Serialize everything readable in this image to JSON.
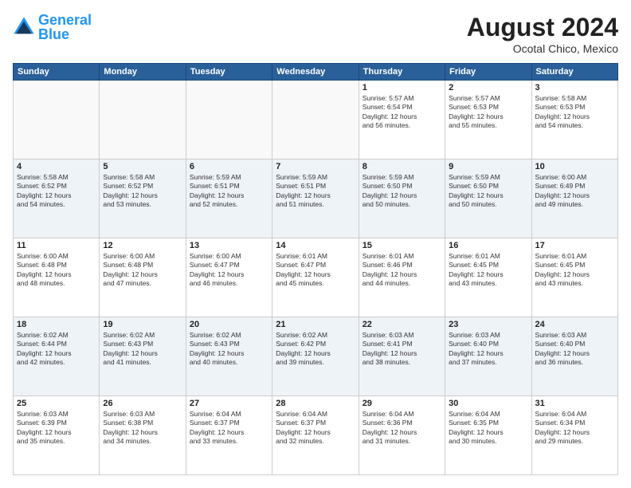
{
  "header": {
    "logo_general": "General",
    "logo_blue": "Blue",
    "month_year": "August 2024",
    "location": "Ocotal Chico, Mexico"
  },
  "weekdays": [
    "Sunday",
    "Monday",
    "Tuesday",
    "Wednesday",
    "Thursday",
    "Friday",
    "Saturday"
  ],
  "rows": [
    {
      "alt": false,
      "cells": [
        {
          "empty": true,
          "day": "",
          "text": ""
        },
        {
          "empty": true,
          "day": "",
          "text": ""
        },
        {
          "empty": true,
          "day": "",
          "text": ""
        },
        {
          "empty": true,
          "day": "",
          "text": ""
        },
        {
          "empty": false,
          "day": "1",
          "text": "Sunrise: 5:57 AM\nSunset: 6:54 PM\nDaylight: 12 hours\nand 56 minutes."
        },
        {
          "empty": false,
          "day": "2",
          "text": "Sunrise: 5:57 AM\nSunset: 6:53 PM\nDaylight: 12 hours\nand 55 minutes."
        },
        {
          "empty": false,
          "day": "3",
          "text": "Sunrise: 5:58 AM\nSunset: 6:53 PM\nDaylight: 12 hours\nand 54 minutes."
        }
      ]
    },
    {
      "alt": true,
      "cells": [
        {
          "empty": false,
          "day": "4",
          "text": "Sunrise: 5:58 AM\nSunset: 6:52 PM\nDaylight: 12 hours\nand 54 minutes."
        },
        {
          "empty": false,
          "day": "5",
          "text": "Sunrise: 5:58 AM\nSunset: 6:52 PM\nDaylight: 12 hours\nand 53 minutes."
        },
        {
          "empty": false,
          "day": "6",
          "text": "Sunrise: 5:59 AM\nSunset: 6:51 PM\nDaylight: 12 hours\nand 52 minutes."
        },
        {
          "empty": false,
          "day": "7",
          "text": "Sunrise: 5:59 AM\nSunset: 6:51 PM\nDaylight: 12 hours\nand 51 minutes."
        },
        {
          "empty": false,
          "day": "8",
          "text": "Sunrise: 5:59 AM\nSunset: 6:50 PM\nDaylight: 12 hours\nand 50 minutes."
        },
        {
          "empty": false,
          "day": "9",
          "text": "Sunrise: 5:59 AM\nSunset: 6:50 PM\nDaylight: 12 hours\nand 50 minutes."
        },
        {
          "empty": false,
          "day": "10",
          "text": "Sunrise: 6:00 AM\nSunset: 6:49 PM\nDaylight: 12 hours\nand 49 minutes."
        }
      ]
    },
    {
      "alt": false,
      "cells": [
        {
          "empty": false,
          "day": "11",
          "text": "Sunrise: 6:00 AM\nSunset: 6:48 PM\nDaylight: 12 hours\nand 48 minutes."
        },
        {
          "empty": false,
          "day": "12",
          "text": "Sunrise: 6:00 AM\nSunset: 6:48 PM\nDaylight: 12 hours\nand 47 minutes."
        },
        {
          "empty": false,
          "day": "13",
          "text": "Sunrise: 6:00 AM\nSunset: 6:47 PM\nDaylight: 12 hours\nand 46 minutes."
        },
        {
          "empty": false,
          "day": "14",
          "text": "Sunrise: 6:01 AM\nSunset: 6:47 PM\nDaylight: 12 hours\nand 45 minutes."
        },
        {
          "empty": false,
          "day": "15",
          "text": "Sunrise: 6:01 AM\nSunset: 6:46 PM\nDaylight: 12 hours\nand 44 minutes."
        },
        {
          "empty": false,
          "day": "16",
          "text": "Sunrise: 6:01 AM\nSunset: 6:45 PM\nDaylight: 12 hours\nand 43 minutes."
        },
        {
          "empty": false,
          "day": "17",
          "text": "Sunrise: 6:01 AM\nSunset: 6:45 PM\nDaylight: 12 hours\nand 43 minutes."
        }
      ]
    },
    {
      "alt": true,
      "cells": [
        {
          "empty": false,
          "day": "18",
          "text": "Sunrise: 6:02 AM\nSunset: 6:44 PM\nDaylight: 12 hours\nand 42 minutes."
        },
        {
          "empty": false,
          "day": "19",
          "text": "Sunrise: 6:02 AM\nSunset: 6:43 PM\nDaylight: 12 hours\nand 41 minutes."
        },
        {
          "empty": false,
          "day": "20",
          "text": "Sunrise: 6:02 AM\nSunset: 6:43 PM\nDaylight: 12 hours\nand 40 minutes."
        },
        {
          "empty": false,
          "day": "21",
          "text": "Sunrise: 6:02 AM\nSunset: 6:42 PM\nDaylight: 12 hours\nand 39 minutes."
        },
        {
          "empty": false,
          "day": "22",
          "text": "Sunrise: 6:03 AM\nSunset: 6:41 PM\nDaylight: 12 hours\nand 38 minutes."
        },
        {
          "empty": false,
          "day": "23",
          "text": "Sunrise: 6:03 AM\nSunset: 6:40 PM\nDaylight: 12 hours\nand 37 minutes."
        },
        {
          "empty": false,
          "day": "24",
          "text": "Sunrise: 6:03 AM\nSunset: 6:40 PM\nDaylight: 12 hours\nand 36 minutes."
        }
      ]
    },
    {
      "alt": false,
      "cells": [
        {
          "empty": false,
          "day": "25",
          "text": "Sunrise: 6:03 AM\nSunset: 6:39 PM\nDaylight: 12 hours\nand 35 minutes."
        },
        {
          "empty": false,
          "day": "26",
          "text": "Sunrise: 6:03 AM\nSunset: 6:38 PM\nDaylight: 12 hours\nand 34 minutes."
        },
        {
          "empty": false,
          "day": "27",
          "text": "Sunrise: 6:04 AM\nSunset: 6:37 PM\nDaylight: 12 hours\nand 33 minutes."
        },
        {
          "empty": false,
          "day": "28",
          "text": "Sunrise: 6:04 AM\nSunset: 6:37 PM\nDaylight: 12 hours\nand 32 minutes."
        },
        {
          "empty": false,
          "day": "29",
          "text": "Sunrise: 6:04 AM\nSunset: 6:36 PM\nDaylight: 12 hours\nand 31 minutes."
        },
        {
          "empty": false,
          "day": "30",
          "text": "Sunrise: 6:04 AM\nSunset: 6:35 PM\nDaylight: 12 hours\nand 30 minutes."
        },
        {
          "empty": false,
          "day": "31",
          "text": "Sunrise: 6:04 AM\nSunset: 6:34 PM\nDaylight: 12 hours\nand 29 minutes."
        }
      ]
    }
  ]
}
